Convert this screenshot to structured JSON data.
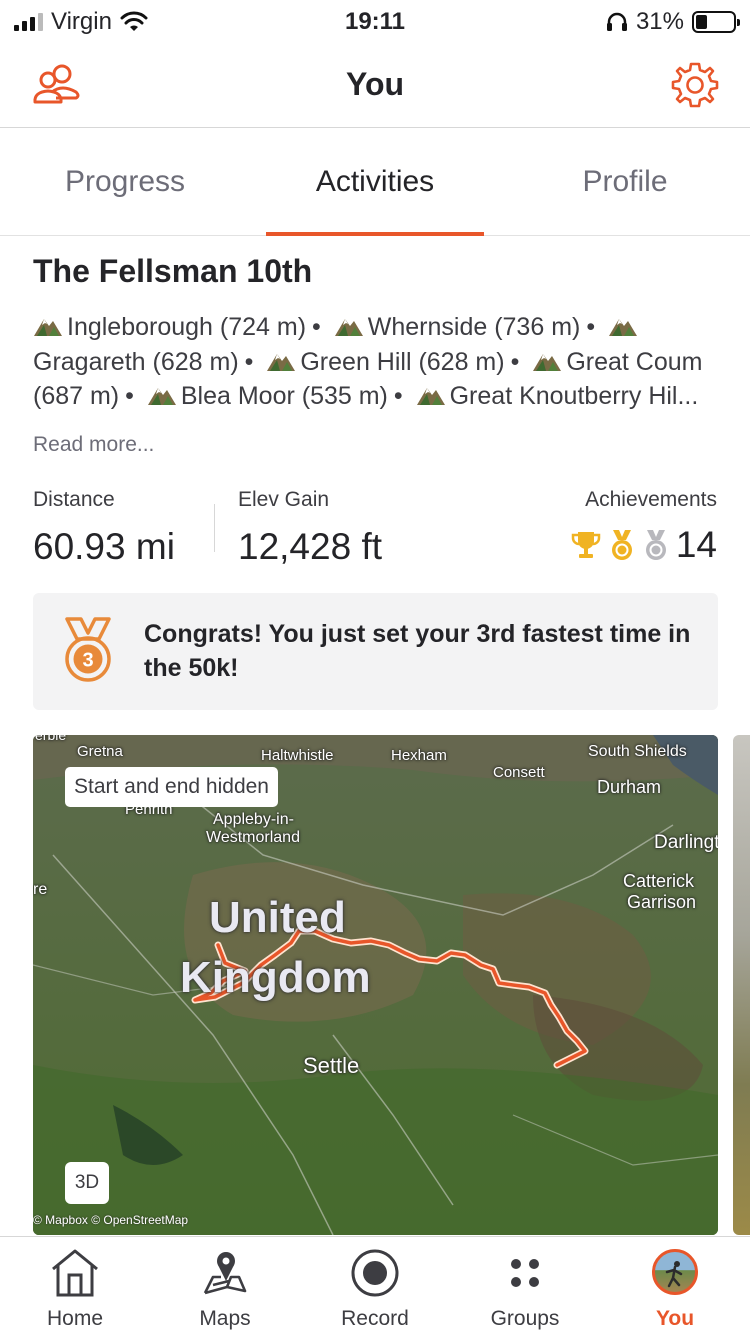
{
  "status_bar": {
    "carrier": "Virgin",
    "time": "19:11",
    "battery": "31%"
  },
  "nav": {
    "title": "You",
    "left_icon": "friends-icon",
    "right_icon": "gear-icon"
  },
  "tabs": [
    {
      "label": "Progress",
      "active": false
    },
    {
      "label": "Activities",
      "active": true
    },
    {
      "label": "Profile",
      "active": false
    }
  ],
  "activity": {
    "title": "The Fellsman 10th",
    "peaks": [
      "Ingleborough (724 m)",
      "Whernside (736 m)",
      "Gragareth (628 m)",
      "Green Hill (628 m)",
      "Great Coum (687 m)",
      "Blea Moor (535 m)",
      "Great Knoutberry Hil..."
    ],
    "read_more": "Read more...",
    "stats": {
      "distance_label": "Distance",
      "distance_value": "60.93 mi",
      "elev_label": "Elev Gain",
      "elev_value": "12,428 ft",
      "achievements_label": "Achievements",
      "achievements_value": "14"
    },
    "congrats": "Congrats! You just set your 3rd fastest time in the 50k!",
    "medal_number": "3"
  },
  "map": {
    "hidden_label": "Start and end hidden",
    "button_3d": "3D",
    "attribution": "© Mapbox © OpenStreetMap",
    "place_labels": {
      "top_cut": "erble",
      "gretna": "Gretna",
      "haltwhistle": "Haltwhistle",
      "hexham": "Hexham",
      "south_shields": "South Shields",
      "consett": "Consett",
      "durham": "Durham",
      "penrith": "Penrith",
      "appleby": "Appleby-in-",
      "appleby2": "Westmorland",
      "darlington": "Darlingt",
      "left_cut": "re",
      "catterick": "Catterick",
      "catterick2": "Garrison",
      "uk1": "United",
      "uk2": "Kingdom",
      "settle": "Settle"
    }
  },
  "bottom_nav": [
    {
      "label": "Home",
      "icon": "home-icon",
      "active": false
    },
    {
      "label": "Maps",
      "icon": "map-pin-icon",
      "active": false
    },
    {
      "label": "Record",
      "icon": "record-icon",
      "active": false
    },
    {
      "label": "Groups",
      "icon": "groups-icon",
      "active": false
    },
    {
      "label": "You",
      "icon": "avatar",
      "active": true
    }
  ],
  "colors": {
    "accent": "#e8562a",
    "gold": "#f0b323",
    "silver": "#b8b8bd",
    "bronze": "#e88a3a"
  }
}
